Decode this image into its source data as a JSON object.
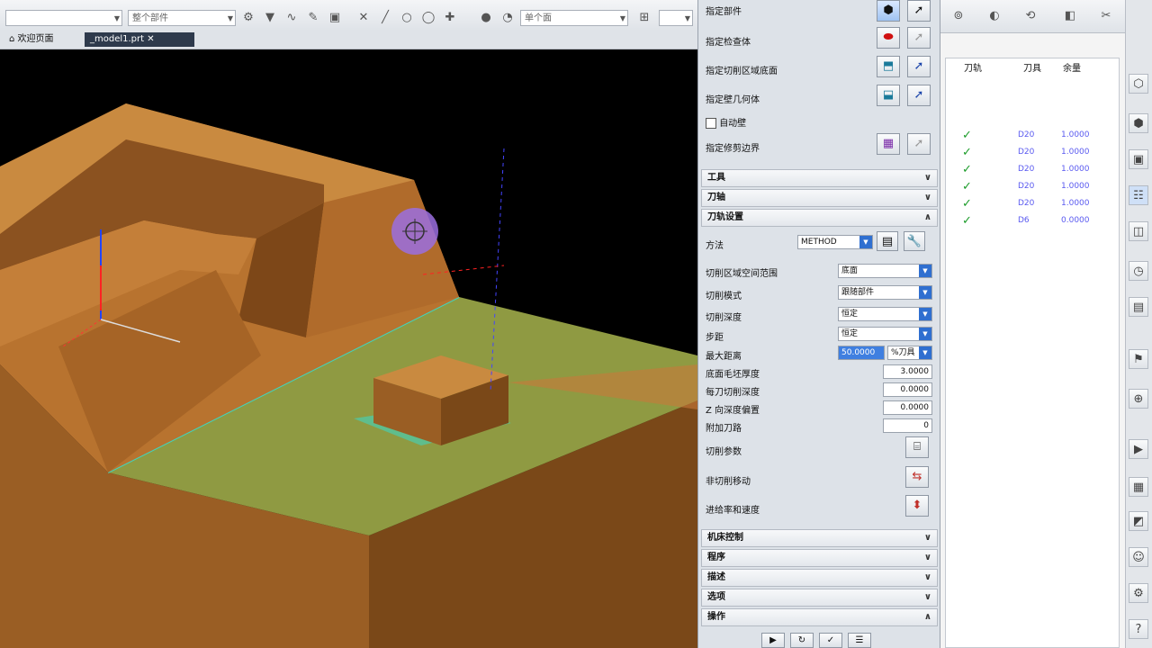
{
  "toolbar": {
    "combo1": "",
    "combo2": "整个部件",
    "combo3": "单个面",
    "combo4": ""
  },
  "tabs": {
    "tab1": "欢迎页面",
    "tab2": "_model1.prt"
  },
  "dialog": {
    "geometry_rows": [
      {
        "label": "指定部件"
      },
      {
        "label": "指定检查体"
      },
      {
        "label": "指定切削区域底面"
      },
      {
        "label": "指定壁几何体"
      },
      {
        "label": "指定修剪边界"
      }
    ],
    "auto_wall": "自动壁",
    "sections": {
      "tool": "工具",
      "axis": "刀轴",
      "path_settings": "刀轨设置",
      "machine_control": "机床控制",
      "program": "程序",
      "description": "描述",
      "options": "选项",
      "actions": "操作"
    },
    "method_label": "方法",
    "method_value": "METHOD",
    "params": [
      {
        "label": "切削区域空间范围",
        "value": "底面"
      },
      {
        "label": "切削模式",
        "value": "跟随部件"
      },
      {
        "label": "切削深度",
        "value": "恒定"
      },
      {
        "label": "步距",
        "value": "恒定"
      },
      {
        "label": "最大距离",
        "value": "50.0000"
      },
      {
        "label": "底面毛坯厚度",
        "value": "3.0000"
      },
      {
        "label": "每刀切削深度",
        "value": "0.0000"
      },
      {
        "label": "Z 向深度偏置",
        "value": "0.0000"
      },
      {
        "label": "附加刀路",
        "value": "0"
      }
    ],
    "unit": "%刀具",
    "action_rows": [
      {
        "label": "切削参数"
      },
      {
        "label": "非切削移动"
      },
      {
        "label": "进给率和速度"
      }
    ]
  },
  "op_list": {
    "headers": [
      "刀轨",
      "刀具",
      "余量"
    ],
    "rows": [
      {
        "tool": "D20",
        "stock": "1.0000"
      },
      {
        "tool": "D20",
        "stock": "1.0000"
      },
      {
        "tool": "D20",
        "stock": "1.0000"
      },
      {
        "tool": "D20",
        "stock": "1.0000"
      },
      {
        "tool": "D20",
        "stock": "1.0000"
      },
      {
        "tool": "D6",
        "stock": "0.0000"
      }
    ]
  },
  "colors": {
    "part": "#b8732f",
    "floor": "#8f9a42",
    "background": "#000000"
  }
}
